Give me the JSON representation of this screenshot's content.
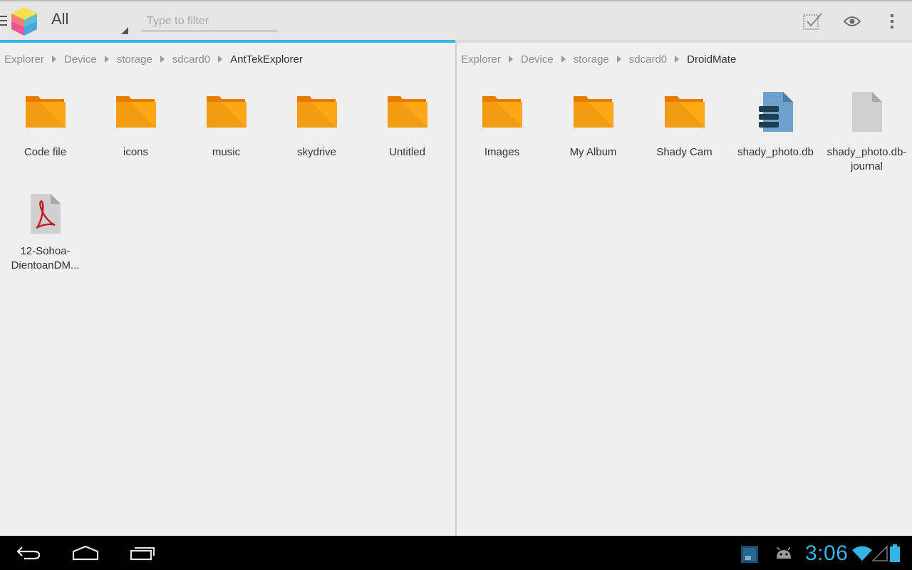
{
  "actionbar": {
    "spinner_label": "All",
    "filter_placeholder": "Type to filter",
    "filter_value": ""
  },
  "colors": {
    "accent": "#33b5e5",
    "folder_front": "#ffa617",
    "folder_back": "#e47d00",
    "db_blue": "#6f9fcc",
    "pdf_red": "#c41a24"
  },
  "left_pane": {
    "breadcrumb": [
      "Explorer",
      "Device",
      "storage",
      "sdcard0",
      "AntTekExplorer"
    ],
    "items": [
      {
        "name": "Code file",
        "icon": "folder-icon"
      },
      {
        "name": "icons",
        "icon": "folder-icon"
      },
      {
        "name": "music",
        "icon": "folder-icon"
      },
      {
        "name": "skydrive",
        "icon": "folder-icon"
      },
      {
        "name": "Untitled",
        "icon": "folder-icon"
      },
      {
        "name_line1": "12-Sohoa-",
        "name_line2": "DientoanDM...",
        "icon": "pdf-file-icon"
      }
    ]
  },
  "right_pane": {
    "breadcrumb": [
      "Explorer",
      "Device",
      "storage",
      "sdcard0",
      "DroidMate"
    ],
    "items": [
      {
        "name": "Images",
        "icon": "folder-icon"
      },
      {
        "name": "My Album",
        "icon": "folder-icon"
      },
      {
        "name": "Shady Cam",
        "icon": "folder-icon"
      },
      {
        "name": "shady_photo.db",
        "icon": "database-file-icon"
      },
      {
        "name_line1": "shady_photo.db-",
        "name_line2": "journal",
        "icon": "generic-file-icon"
      }
    ]
  },
  "statusbar": {
    "time": "3:06"
  }
}
